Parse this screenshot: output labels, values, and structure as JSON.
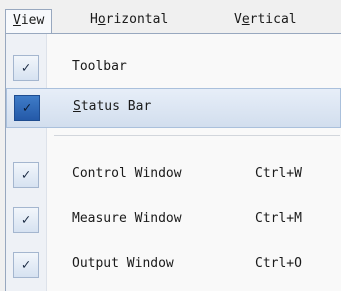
{
  "menubar": {
    "items": [
      {
        "pre": "",
        "key": "V",
        "post": "iew"
      },
      {
        "pre": "H",
        "key": "o",
        "post": "rizontal"
      },
      {
        "pre": "V",
        "key": "e",
        "post": "rtical"
      }
    ]
  },
  "dropdown": {
    "items": [
      {
        "label": "Toolbar",
        "checked": true,
        "shortcut": ""
      },
      {
        "label_key": "S",
        "label_rest": "tatus Bar",
        "checked": true,
        "highlighted": true,
        "shortcut": ""
      },
      {
        "label": "Control Window",
        "checked": true,
        "shortcut": "Ctrl+W"
      },
      {
        "label": "Measure Window",
        "checked": true,
        "shortcut": "Ctrl+M"
      },
      {
        "label": "Output Window",
        "checked": true,
        "shortcut": "Ctrl+O"
      }
    ],
    "check_glyph": "✓"
  },
  "colors": {
    "highlight": "#d2deee",
    "check_dark": "#2459a8",
    "menu_bg": "#f0f0f0"
  }
}
